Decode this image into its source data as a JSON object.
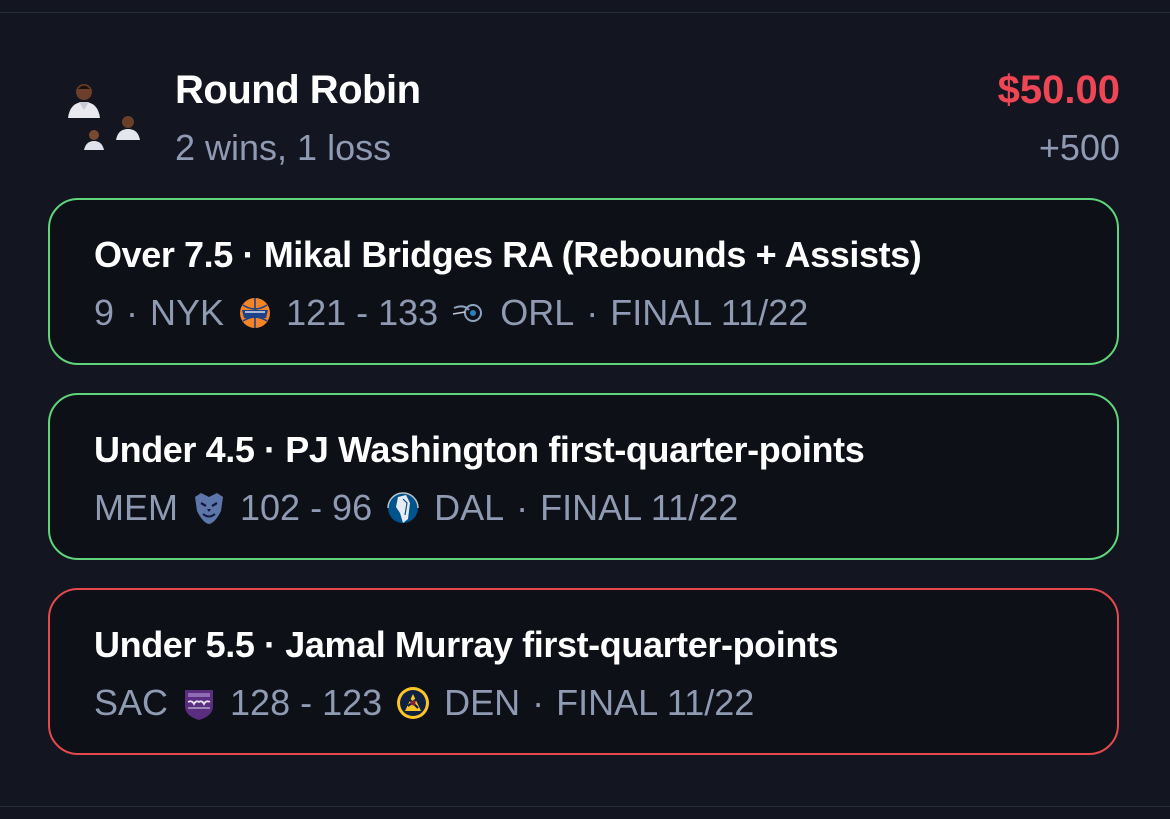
{
  "header": {
    "title": "Round Robin",
    "record": "2 wins, 1 loss",
    "stake": "$50.00",
    "odds": "+500"
  },
  "colors": {
    "background": "#131620",
    "win_border": "#5fd47a",
    "loss_border": "#e5484d",
    "stake_red": "#ee4655",
    "muted_text": "#8f9ab3"
  },
  "legs": [
    {
      "result": "win",
      "title": "Over 7.5 · Mikal Bridges RA (Rebounds + Assists)",
      "stat_value": "9",
      "team_a": "NYK",
      "team_a_logo": "knicks-logo-icon",
      "score": "121 - 133",
      "team_b": "ORL",
      "team_b_logo": "magic-logo-icon",
      "status": "FINAL 11/22"
    },
    {
      "result": "win",
      "title": "Under 4.5 · PJ Washington first-quarter-points",
      "team_a": "MEM",
      "team_a_logo": "grizzlies-logo-icon",
      "score": "102 - 96",
      "team_b": "DAL",
      "team_b_logo": "mavericks-logo-icon",
      "status": "FINAL 11/22"
    },
    {
      "result": "loss",
      "title": "Under 5.5 · Jamal Murray first-quarter-points",
      "team_a": "SAC",
      "team_a_logo": "kings-logo-icon",
      "score": "128 - 123",
      "team_b": "DEN",
      "team_b_logo": "nuggets-logo-icon",
      "status": "FINAL 11/22"
    }
  ]
}
